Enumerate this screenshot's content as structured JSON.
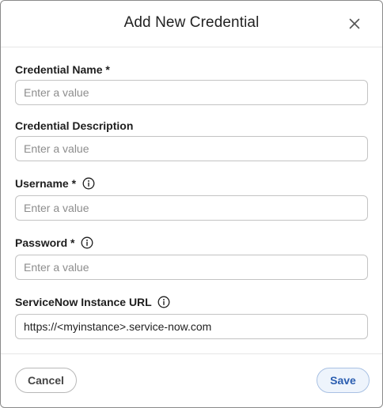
{
  "dialog": {
    "title": "Add New Credential",
    "close_icon": "close-icon"
  },
  "fields": {
    "credential_name": {
      "label": "Credential Name *",
      "placeholder": "Enter a value",
      "value": ""
    },
    "credential_description": {
      "label": "Credential Description",
      "placeholder": "Enter a value",
      "value": ""
    },
    "username": {
      "label": "Username *",
      "placeholder": "Enter a value",
      "value": "",
      "info_icon": "info-icon"
    },
    "password": {
      "label": "Password *",
      "placeholder": "Enter a value",
      "value": "",
      "info_icon": "info-icon"
    },
    "servicenow_url": {
      "label": "ServiceNow Instance URL",
      "placeholder": "",
      "value": "https://<myinstance>.service-now.com",
      "info_icon": "info-icon"
    }
  },
  "footer": {
    "cancel_label": "Cancel",
    "save_label": "Save"
  },
  "colors": {
    "save_text": "#2a5db0",
    "save_bg": "#eef4fc",
    "save_border": "#a9c1e3",
    "border": "#c3c3c3"
  }
}
